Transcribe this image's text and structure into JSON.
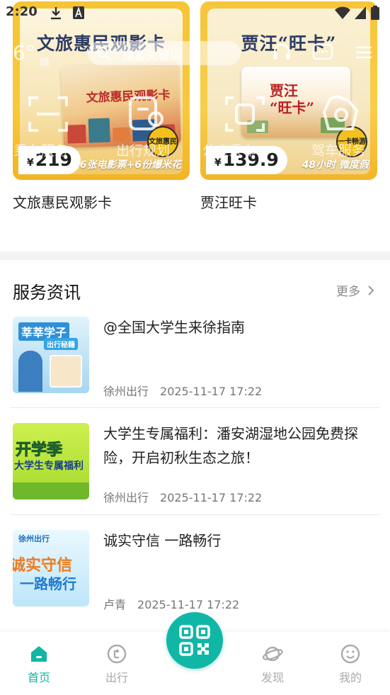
{
  "status_bar": {
    "time": "2:20"
  },
  "header": {
    "temperature": "6°",
    "weather": "晴",
    "search_placeholder": "搜索关键词"
  },
  "quick_services": [
    {
      "label": "乘车服务",
      "icon": "scan-frame-icon"
    },
    {
      "label": "出行规划",
      "icon": "route-plan-icon"
    },
    {
      "label": "公交乘车",
      "icon": "bus-icon"
    },
    {
      "label": "驾车服务",
      "icon": "car-service-icon"
    }
  ],
  "cards": [
    {
      "banner_title": "文旅惠民观影卡",
      "photo_text": "文旅惠民观影卡",
      "badge": "文旅惠民",
      "price_currency": "¥",
      "price": "219",
      "desc": "6张电影票+6份爆米花",
      "name": "文旅惠民观影卡"
    },
    {
      "banner_title": "贾汪“旺卡”",
      "photo_text": "贾汪\n“旺卡”",
      "badge": "一卡畅游",
      "price_currency": "¥",
      "price": "139.9",
      "desc": "48小时 微度假",
      "name": "贾汪旺卡"
    }
  ],
  "news": {
    "title": "服务资讯",
    "more": "更多",
    "items": [
      {
        "headline": "@全国大学生来徐指南",
        "source": "徐州出行",
        "time": "2025-11-17 17:22",
        "thumb_text": "莘莘学子",
        "thumb_sub": "出行秘籍",
        "thumb_colors": [
          "#d9f0fb",
          "#a9d8f3"
        ]
      },
      {
        "headline": "大学生专属福利：潘安湖湿地公园免费探险，开启初秋生态之旅！",
        "source": "徐州出行",
        "time": "2025-11-17 17:22",
        "thumb_text": "开学季",
        "thumb_sub": "大学生专属福利",
        "thumb_colors": [
          "#c7ef4c",
          "#a8dd2c"
        ]
      },
      {
        "headline": "诚实守信 一路畅行",
        "source": "卢青",
        "time": "2025-11-17 17:22",
        "thumb_text": "诚实守信",
        "thumb_sub": "一路畅行",
        "thumb_brand": "徐州出行",
        "thumb_colors": [
          "#e9f8ff",
          "#bfe8fb"
        ]
      }
    ]
  },
  "tabbar": {
    "items": [
      {
        "label": "首页",
        "active": true
      },
      {
        "label": "出行",
        "active": false
      },
      {
        "label": "发现",
        "active": false
      },
      {
        "label": "我的",
        "active": false
      }
    ],
    "accent": "#13b5a5"
  }
}
